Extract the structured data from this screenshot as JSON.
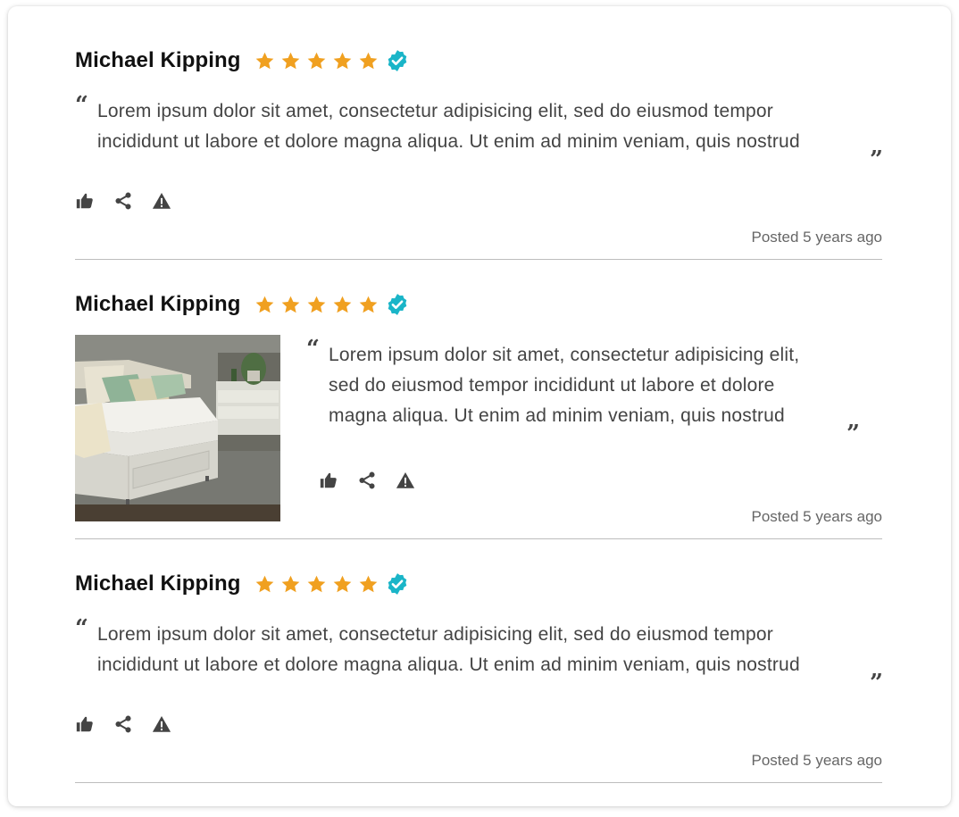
{
  "reviews": [
    {
      "author": "Michael Kipping",
      "rating": 5,
      "verified": true,
      "text_line1": "Lorem ipsum dolor sit amet, consectetur adipisicing elit, sed do eiusmod tempor",
      "text_line2": "incididunt ut labore et dolore magna aliqua. Ut enim ad minim veniam, quis nostrud",
      "posted": "Posted 5 years ago",
      "has_image": false
    },
    {
      "author": "Michael Kipping",
      "rating": 5,
      "verified": true,
      "text_line1": "Lorem ipsum dolor sit amet, consectetur adipisicing elit,",
      "text_line2": "sed do eiusmod tempor incididunt ut labore et dolore",
      "text_line3": "magna aliqua. Ut enim ad minim veniam, quis nostrud",
      "posted": "Posted 5 years ago",
      "has_image": true,
      "image_subject": "mattress-on-bed"
    },
    {
      "author": "Michael Kipping",
      "rating": 5,
      "verified": true,
      "text_line1": "Lorem ipsum dolor sit amet, consectetur adipisicing elit, sed do eiusmod tempor",
      "text_line2": "incididunt ut labore et dolore magna aliqua. Ut enim ad minim veniam, quis nostrud",
      "posted": "Posted 5 years ago",
      "has_image": false
    }
  ],
  "quote_open": "“",
  "quote_close": "”",
  "icons": {
    "star": "star-icon",
    "verified": "verified-badge-icon",
    "like": "thumbs-up-icon",
    "share": "share-icon",
    "report": "warning-icon"
  },
  "colors": {
    "star": "#f0a020",
    "verified": "#1ab5c8",
    "icon": "#444444",
    "divider": "#bdbdbd"
  }
}
